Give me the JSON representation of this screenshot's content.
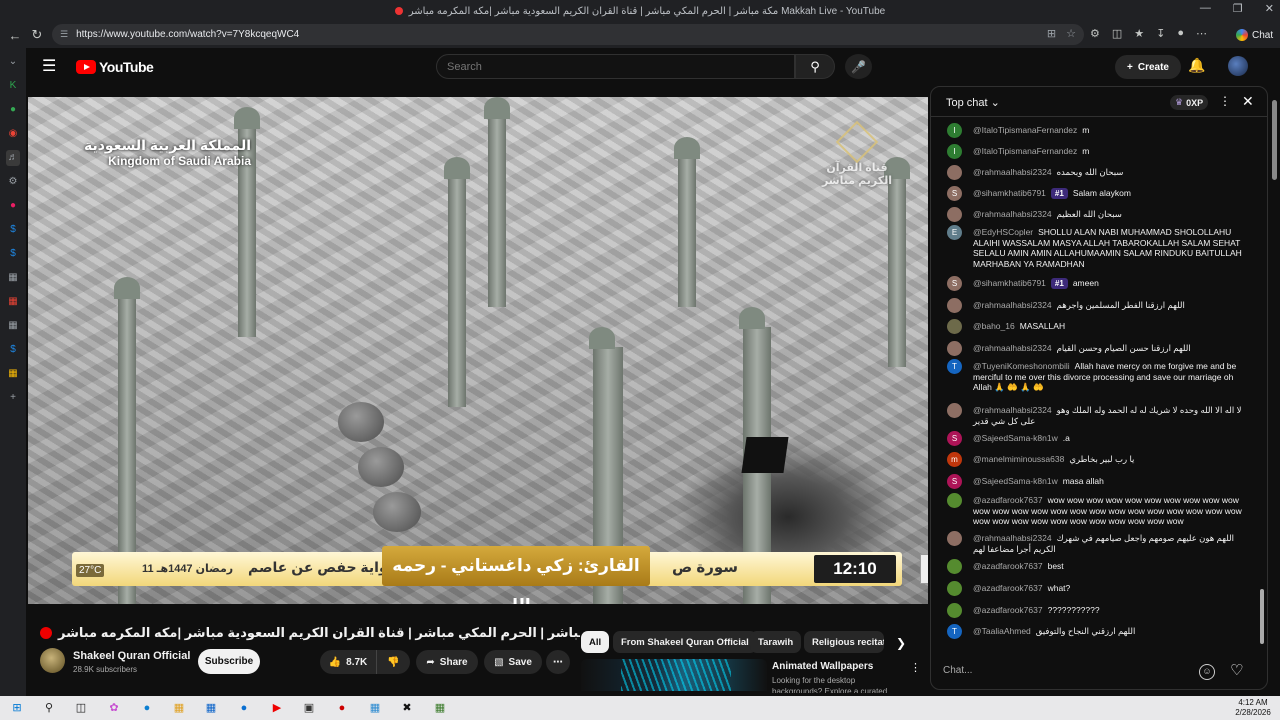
{
  "window": {
    "title": "مكة مباشر | الحرم المكي مباشر | قناة القران الكريم السعودية مباشر |مكه المكرمه مباشر Makkah Live - YouTube",
    "controls": [
      "—",
      "❐",
      "✕"
    ]
  },
  "browser": {
    "url": "https://www.youtube.com/watch?v=7Y8kcqeqWC4",
    "chat_button": "Chat"
  },
  "youtube": {
    "logo_text": "YouTube",
    "search_placeholder": "Search",
    "create_label": "Create"
  },
  "video": {
    "overlay_kingdom_ar": "المملكة العربية السعودية",
    "overlay_kingdom_en": "Kingdom of Saudi Arabia",
    "overlay_channel_logo": "قناة القرآن الكريم مباشر",
    "temperature": "27°C",
    "hijri_date": "11 رمضان 1447هـ",
    "riwaya": "رواية حفص عن عاصم",
    "reader": "القارئ: زكي داغستاني - رحمه الله",
    "surah": "سورة ص",
    "clock": "12:10"
  },
  "video_info": {
    "title": "مكة مباشر | الحرم المكي مباشر | قناة القران الكريم السعودية مباشر |مكه المكرمه مباشر | Makkah Live",
    "channel": "Shakeel Quran Official",
    "subscribers": "28.9K subscribers",
    "subscribe_label": "Subscribe",
    "likes": "8.7K",
    "share_label": "Share",
    "save_label": "Save"
  },
  "related": {
    "chips": [
      "All",
      "From Shakeel Quran Official",
      "Tarawih",
      "Religious recitat"
    ],
    "item_title": "Animated Wallpapers",
    "item_desc": "Looking for the desktop backgrounds? Explore a curated"
  },
  "chat": {
    "header_title": "Top chat",
    "xp_label": "0XP",
    "input_placeholder": "Chat...",
    "messages": [
      {
        "author": "@ItaloTipismanaFernandez",
        "text": "m",
        "initial": "I",
        "color": "#2e7d32"
      },
      {
        "author": "@ItaloTipismanaFernandez",
        "text": "m",
        "initial": "I",
        "color": "#2e7d32"
      },
      {
        "author": "@rahmaalhabsi2324",
        "text": "سبحان الله وبحمده",
        "initial": "",
        "color": "#8d6e63"
      },
      {
        "author": "@sihamkhatib6791",
        "badge": "#1",
        "text": "Salam alaykom",
        "initial": "S",
        "color": "#8d6e63"
      },
      {
        "author": "@rahmaalhabsi2324",
        "text": "سبحان الله العظيم",
        "initial": "",
        "color": "#8d6e63"
      },
      {
        "author": "@EdyHSCopler",
        "text": "SHOLLU ALAN NABI MUHAMMAD SHOLOLLAHU ALAIHI WASSALAM MASYA ALLAH TABAROKALLAH SALAM SEHAT SELALU AMIN AMIN ALLAHUMAAMIN SALAM RINDUKU BAITULLAH MARHABAN YA RAMADHAN",
        "initial": "E",
        "color": "#607d8b"
      },
      {
        "author": "@sihamkhatib6791",
        "badge": "#1",
        "text": "ameen",
        "initial": "S",
        "color": "#8d6e63"
      },
      {
        "author": "@rahmaalhabsi2324",
        "text": "اللهم ارزقنا الفطر المسلمين واجرهم",
        "initial": "",
        "color": "#8d6e63"
      },
      {
        "author": "@baho_16",
        "text": "MASALLAH",
        "initial": "",
        "color": "#6d6a4a"
      },
      {
        "author": "@rahmaalhabsi2324",
        "text": "اللهم ارزقنا حسن الصيام وحسن القيام",
        "initial": "",
        "color": "#8d6e63"
      },
      {
        "author": "@TuyeniKomeshonombili",
        "text": "Allah have mercy on me forgive me and be merciful to me over this divorce processing and save our marriage oh Allah 🙏 🤲 🙏 🤲",
        "initial": "T",
        "color": "#1565c0"
      },
      {
        "author": "@rahmaalhabsi2324",
        "text": "لا اله الا الله وحده لا شريك له له الحمد وله الملك وهو على كل شي قدير",
        "initial": "",
        "color": "#8d6e63"
      },
      {
        "author": "@SajeedSama-k8n1w",
        "text": ".a",
        "initial": "S",
        "color": "#ad1457"
      },
      {
        "author": "@manelmiminoussa638",
        "text": "يا رب لبير بخاطري",
        "initial": "m",
        "color": "#bf360c"
      },
      {
        "author": "@SajeedSama-k8n1w",
        "text": "masa allah",
        "initial": "S",
        "color": "#ad1457"
      },
      {
        "author": "@azadfarook7637",
        "text": "wow wow wow wow wow wow wow wow wow wow wow wow wow wow wow wow wow wow wow wow wow wow wow wow wow wow wow wow wow wow wow wow wow wow wow",
        "initial": "",
        "color": "#558b2f"
      },
      {
        "author": "@rahmaalhabsi2324",
        "text": "اللهم هون عليهم صومهم واجعل صيامهم في شهرك الكريم أجرا مضاعفا لهم",
        "initial": "",
        "color": "#8d6e63"
      },
      {
        "author": "@azadfarook7637",
        "text": "best",
        "initial": "",
        "color": "#558b2f"
      },
      {
        "author": "@azadfarook7637",
        "text": "what?",
        "initial": "",
        "color": "#558b2f"
      },
      {
        "author": "@azadfarook7637",
        "text": "???????????",
        "initial": "",
        "color": "#558b2f"
      },
      {
        "author": "@TaaliaAhmed",
        "text": "اللهم ارزقني النجاح والتوفيق",
        "initial": "T",
        "color": "#1565c0"
      }
    ]
  },
  "taskbar": {
    "time": "4:12 AM",
    "date": "2/28/2026"
  }
}
